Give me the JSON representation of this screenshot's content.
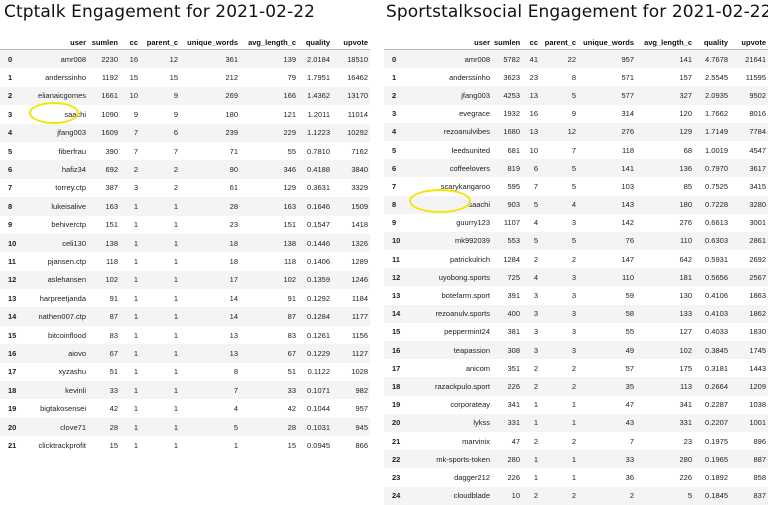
{
  "left": {
    "title": "Ctptalk Engagement for 2021-02-22",
    "columns": [
      "",
      "user",
      "sumlen",
      "cc",
      "parent_c",
      "unique_words",
      "avg_length_c",
      "quality",
      "upvote"
    ],
    "rows": [
      [
        "0",
        "amr008",
        "2230",
        "16",
        "12",
        "361",
        "139",
        "2.0184",
        "18510"
      ],
      [
        "1",
        "anderssinho",
        "1192",
        "15",
        "15",
        "212",
        "79",
        "1.7951",
        "16462"
      ],
      [
        "2",
        "elianaicgomes",
        "1661",
        "10",
        "9",
        "269",
        "166",
        "1.4362",
        "13170"
      ],
      [
        "3",
        "saachi",
        "1090",
        "9",
        "9",
        "180",
        "121",
        "1.2011",
        "11014"
      ],
      [
        "4",
        "jfang003",
        "1609",
        "7",
        "6",
        "239",
        "229",
        "1.1223",
        "10292"
      ],
      [
        "5",
        "fiberfrau",
        "390",
        "7",
        "7",
        "71",
        "55",
        "0.7810",
        "7162"
      ],
      [
        "6",
        "hafiz34",
        "692",
        "2",
        "2",
        "90",
        "346",
        "0.4188",
        "3840"
      ],
      [
        "7",
        "torrey.ctp",
        "387",
        "3",
        "2",
        "61",
        "129",
        "0.3631",
        "3329"
      ],
      [
        "8",
        "lukeisalive",
        "163",
        "1",
        "1",
        "28",
        "163",
        "0.1646",
        "1509"
      ],
      [
        "9",
        "behiverctp",
        "151",
        "1",
        "1",
        "23",
        "151",
        "0.1547",
        "1418"
      ],
      [
        "10",
        "celi130",
        "138",
        "1",
        "1",
        "18",
        "138",
        "0.1446",
        "1326"
      ],
      [
        "11",
        "pjansen.ctp",
        "118",
        "1",
        "1",
        "18",
        "118",
        "0.1406",
        "1289"
      ],
      [
        "12",
        "aslehansen",
        "102",
        "1",
        "1",
        "17",
        "102",
        "0.1359",
        "1246"
      ],
      [
        "13",
        "harpreetjanda",
        "91",
        "1",
        "1",
        "14",
        "91",
        "0.1292",
        "1184"
      ],
      [
        "14",
        "nathen007.ctp",
        "87",
        "1",
        "1",
        "14",
        "87",
        "0.1284",
        "1177"
      ],
      [
        "15",
        "bitcoinflood",
        "83",
        "1",
        "1",
        "13",
        "83",
        "0.1261",
        "1156"
      ],
      [
        "16",
        "aiovo",
        "67",
        "1",
        "1",
        "13",
        "67",
        "0.1229",
        "1127"
      ],
      [
        "17",
        "xyzashu",
        "51",
        "1",
        "1",
        "8",
        "51",
        "0.1122",
        "1028"
      ],
      [
        "18",
        "kevinli",
        "33",
        "1",
        "1",
        "7",
        "33",
        "0.1071",
        "982"
      ],
      [
        "19",
        "bigtakosensei",
        "42",
        "1",
        "1",
        "4",
        "42",
        "0.1044",
        "957"
      ],
      [
        "20",
        "clove71",
        "28",
        "1",
        "1",
        "5",
        "28",
        "0.1031",
        "945"
      ],
      [
        "21",
        "clicktrackprofit",
        "15",
        "1",
        "1",
        "1",
        "15",
        "0.0945",
        "866"
      ]
    ]
  },
  "right": {
    "title": "Sportstalksocial Engagement for 2021-02-22",
    "columns": [
      "",
      "user",
      "sumlen",
      "cc",
      "parent_c",
      "unique_words",
      "avg_length_c",
      "quality",
      "upvote"
    ],
    "rows": [
      [
        "0",
        "amr008",
        "5782",
        "41",
        "22",
        "957",
        "141",
        "4.7678",
        "21641"
      ],
      [
        "1",
        "anderssinho",
        "3623",
        "23",
        "8",
        "571",
        "157",
        "2.5545",
        "11595"
      ],
      [
        "2",
        "jfang003",
        "4253",
        "13",
        "5",
        "577",
        "327",
        "2.0935",
        "9502"
      ],
      [
        "3",
        "evegrace",
        "1932",
        "16",
        "9",
        "314",
        "120",
        "1.7662",
        "8016"
      ],
      [
        "4",
        "rezoanulvibes",
        "1680",
        "13",
        "12",
        "276",
        "129",
        "1.7149",
        "7784"
      ],
      [
        "5",
        "leedsunited",
        "681",
        "10",
        "7",
        "118",
        "68",
        "1.0019",
        "4547"
      ],
      [
        "6",
        "coffeelovers",
        "819",
        "6",
        "5",
        "141",
        "136",
        "0.7970",
        "3617"
      ],
      [
        "7",
        "scarykangaroo",
        "595",
        "7",
        "5",
        "103",
        "85",
        "0.7525",
        "3415"
      ],
      [
        "8",
        "saachi",
        "903",
        "5",
        "4",
        "143",
        "180",
        "0.7228",
        "3280"
      ],
      [
        "9",
        "guurry123",
        "1107",
        "4",
        "3",
        "142",
        "276",
        "0.6613",
        "3001"
      ],
      [
        "10",
        "mk992039",
        "553",
        "5",
        "5",
        "76",
        "110",
        "0.6303",
        "2861"
      ],
      [
        "11",
        "patrickulrich",
        "1284",
        "2",
        "2",
        "147",
        "642",
        "0.5931",
        "2692"
      ],
      [
        "12",
        "uyobong.sports",
        "725",
        "4",
        "3",
        "110",
        "181",
        "0.5656",
        "2567"
      ],
      [
        "13",
        "botefarm.sport",
        "391",
        "3",
        "3",
        "59",
        "130",
        "0.4106",
        "1863"
      ],
      [
        "14",
        "rezoanulv.sports",
        "400",
        "3",
        "3",
        "58",
        "133",
        "0.4103",
        "1862"
      ],
      [
        "15",
        "peppermint24",
        "381",
        "3",
        "3",
        "55",
        "127",
        "0.4033",
        "1830"
      ],
      [
        "16",
        "teapassion",
        "308",
        "3",
        "3",
        "49",
        "102",
        "0.3845",
        "1745"
      ],
      [
        "17",
        "anicom",
        "351",
        "2",
        "2",
        "57",
        "175",
        "0.3181",
        "1443"
      ],
      [
        "18",
        "razackpulo.sport",
        "226",
        "2",
        "2",
        "35",
        "113",
        "0.2664",
        "1209"
      ],
      [
        "19",
        "corporateay",
        "341",
        "1",
        "1",
        "47",
        "341",
        "0.2287",
        "1038"
      ],
      [
        "20",
        "lykss",
        "331",
        "1",
        "1",
        "43",
        "331",
        "0.2207",
        "1001"
      ],
      [
        "21",
        "marvinix",
        "47",
        "2",
        "2",
        "7",
        "23",
        "0.1975",
        "896"
      ],
      [
        "22",
        "mk-sports-token",
        "280",
        "1",
        "1",
        "33",
        "280",
        "0.1965",
        "887"
      ],
      [
        "23",
        "dagger212",
        "226",
        "1",
        "1",
        "36",
        "226",
        "0.1892",
        "858"
      ],
      [
        "24",
        "cloudblade",
        "10",
        "2",
        "2",
        "2",
        "5",
        "0.1845",
        "837"
      ]
    ]
  }
}
